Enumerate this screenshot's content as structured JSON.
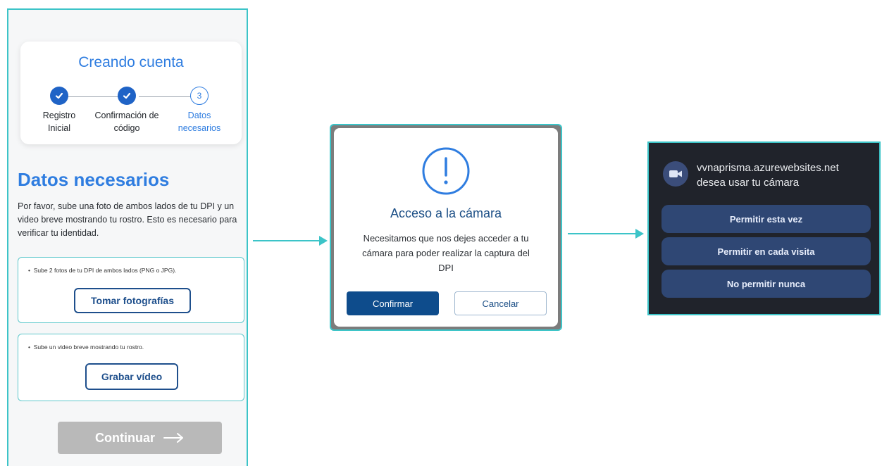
{
  "phone": {
    "card_title": "Creando cuenta",
    "steps": [
      {
        "label": "Registro\nInicial",
        "status": "done"
      },
      {
        "label": "Confirmación de\ncódigo",
        "status": "done"
      },
      {
        "number": "3",
        "label": "Datos\nnecesarios",
        "status": "current"
      }
    ],
    "section_title": "Datos necesarios",
    "section_description": "Por favor, sube una foto de ambos lados de tu DPI y un video breve mostrando tu rostro. Esto es necesario para verificar tu identidad.",
    "photo_box": {
      "hint": "Sube 2 fotos de tu DPI de ambos lados (PNG o JPG).",
      "button": "Tomar fotografías"
    },
    "video_box": {
      "hint": "Sube un video breve mostrando tu rostro.",
      "button": "Grabar vídeo"
    },
    "continue_button": "Continuar"
  },
  "dialog": {
    "icon": "exclamation-circle-icon",
    "title": "Acceso a la cámara",
    "message": "Necesitamos que nos dejes acceder a tu cámara para poder realizar la captura del DPI",
    "confirm_button": "Confirmar",
    "cancel_button": "Cancelar"
  },
  "permission": {
    "icon": "video-camera-icon",
    "host": "vvnaprisma.azurewebsites.net",
    "request": "desea usar tu cámara",
    "buttons": [
      "Permitir esta vez",
      "Permitir en cada visita",
      "No permitir nunca"
    ]
  },
  "colors": {
    "accent_teal": "#3cc4c8",
    "brand_blue": "#2f7de0",
    "navy": "#1e4f8c",
    "disabled_gray": "#b9b9b9"
  }
}
